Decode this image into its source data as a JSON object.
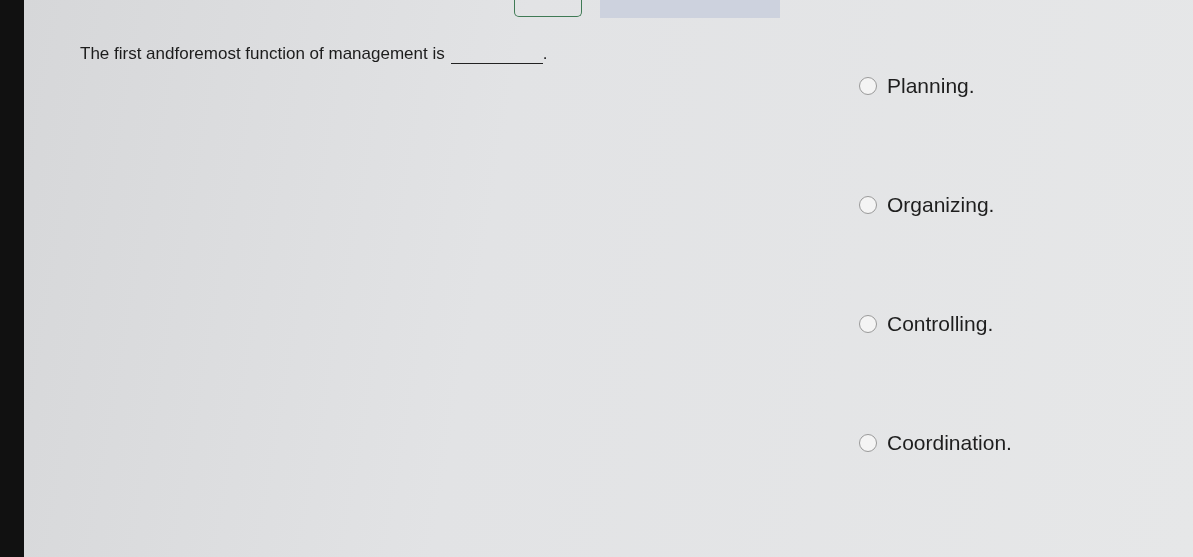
{
  "question": {
    "text": "The first andforemost function of management is",
    "suffix": "."
  },
  "options": [
    {
      "label": "Planning.",
      "selected": false
    },
    {
      "label": "Organizing.",
      "selected": false
    },
    {
      "label": "Controlling.",
      "selected": false
    },
    {
      "label": "Coordination.",
      "selected": false
    }
  ]
}
